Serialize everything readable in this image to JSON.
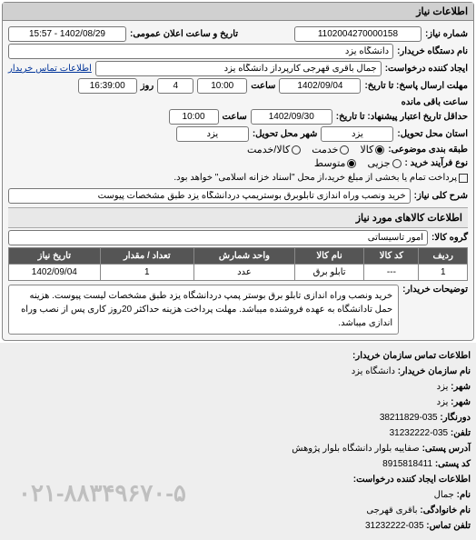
{
  "panel_title": "اطلاعات نیاز",
  "fields": {
    "request_no_label": "شماره نیاز:",
    "request_no": "1102004270000158",
    "announce_label": "تاریخ و ساعت اعلان عمومی:",
    "announce_value": "1402/08/29 - 15:57",
    "buyer_name_label": "نام دستگاه خریدار:",
    "buyer_name": "دانشگاه یزد",
    "creator_label": "ایجاد کننده درخواست:",
    "creator": "جمال باقری قهرجی کارپرداز دانشگاه یزد",
    "buyer_contact_link": "اطلاعات تماس خریدار",
    "deadline_label": "مهلت ارسال پاسخ: تا تاریخ:",
    "deadline_date": "1402/09/04",
    "time_label": "ساعت",
    "deadline_time": "10:00",
    "remaining_num": "4",
    "day_label": "روز",
    "remaining_time": "16:39:00",
    "remaining_label": "ساعت باقی مانده",
    "validity_label": "حداقل تاریخ اعتبار پیشنهاد: تا تاریخ:",
    "validity_date": "1402/09/30",
    "validity_time": "10:00",
    "province_label": "استان محل تحویل:",
    "province": "یزد",
    "city_label": "شهر محل تحویل:",
    "city": "یزد",
    "goods_label": "طبقه بندی موضوعی:",
    "goods_radio": "کالا",
    "service_radio": "خدمت",
    "both_radio": "کالا/خدمت",
    "process_label": "نوع فرآیند خرید :",
    "mid_radio": "متوسط",
    "small_radio": "جزیی",
    "payment_note": "پرداخت تمام یا بخشی از مبلغ خرید،از محل \"اسناد خزانه اسلامی\" خواهد بود.",
    "overview_label": "شرح کلی نیاز:",
    "overview": "خرید ونصب وراه اندازی تابلوبرق بوستریمپ دردانشگاه یزد طبق مشخصات پیوست"
  },
  "goods_section_title": "اطلاعات کالاهای مورد نیاز",
  "goods_group_label": "گروه کالا:",
  "goods_group": "امور تاسیساتی",
  "table": {
    "headers": [
      "ردیف",
      "کد کالا",
      "نام کالا",
      "واحد شمارش",
      "تعداد / مقدار",
      "تاریخ نیاز"
    ],
    "rows": [
      [
        "1",
        "---",
        "تابلو برق",
        "عدد",
        "1",
        "1402/09/04"
      ]
    ]
  },
  "buyer_note_label": "توضیحات خریدار:",
  "buyer_note": "خرید ونصب وراه اندازی تابلو برق بوستر پمپ دردانشگاه یزد طبق مشخصات لیست پیوست. هزینه حمل تادانشگاه به عهده فروشنده میباشد. مهلت پرداخت هزینه حداکثر 20روز کاری پس از نصب وراه اندازی ميباشد.",
  "contact": {
    "title": "اطلاعات تماس سازمان خریدار:",
    "org_label": "نام سازمان خریدار:",
    "org": "دانشگاه یزد",
    "province_label": "شهر:",
    "province": "یزد",
    "city_label": "شهر:",
    "city": "یزد",
    "fax_label": "دورنگار:",
    "fax": "035-38211829",
    "phone_label": "تلفن:",
    "phone": "035-31232222",
    "address_label": "آدرس پستی:",
    "address": "صفاییه بلوار دانشگاه بلوار پژوهش",
    "postcode_label": "کد پستی:",
    "postcode": "8915818411",
    "creator_info_label": "اطلاعات ایجاد کننده درخواست:",
    "first_label": "نام:",
    "first": "جمال",
    "last_label": "نام خانوادگی:",
    "last": "باقری قهرجی",
    "contact_phone_label": "تلفن تماس:",
    "contact_phone": "035-31232222"
  },
  "watermark": "۰۲۱-۸۸۳۴۹۶۷۰-۵"
}
